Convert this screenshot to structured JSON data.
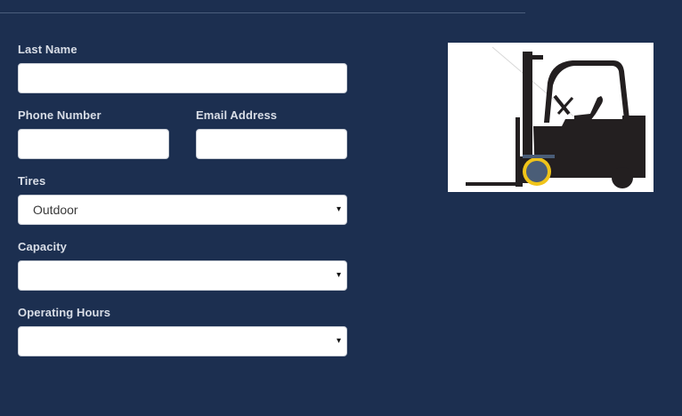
{
  "form": {
    "last_name": {
      "label": "Last Name",
      "value": "",
      "placeholder": ""
    },
    "phone_number": {
      "label": "Phone Number",
      "value": "",
      "placeholder": ""
    },
    "email_address": {
      "label": "Email Address",
      "value": "",
      "placeholder": ""
    },
    "tires": {
      "label": "Tires",
      "selected": "Outdoor",
      "caret": "▾"
    },
    "capacity": {
      "label": "Capacity",
      "selected": "",
      "caret": "▾"
    },
    "operating_hours": {
      "label": "Operating Hours",
      "selected": "",
      "caret": "▾"
    }
  },
  "image": {
    "icon": "forklift-icon"
  },
  "colors": {
    "background": "#1c2f50",
    "label_text": "#d9dee7",
    "field_bg": "#ffffff",
    "forklift_body": "#231f20",
    "wheel_ring": "#f0c419",
    "wheel_hub": "#4a5d77"
  }
}
